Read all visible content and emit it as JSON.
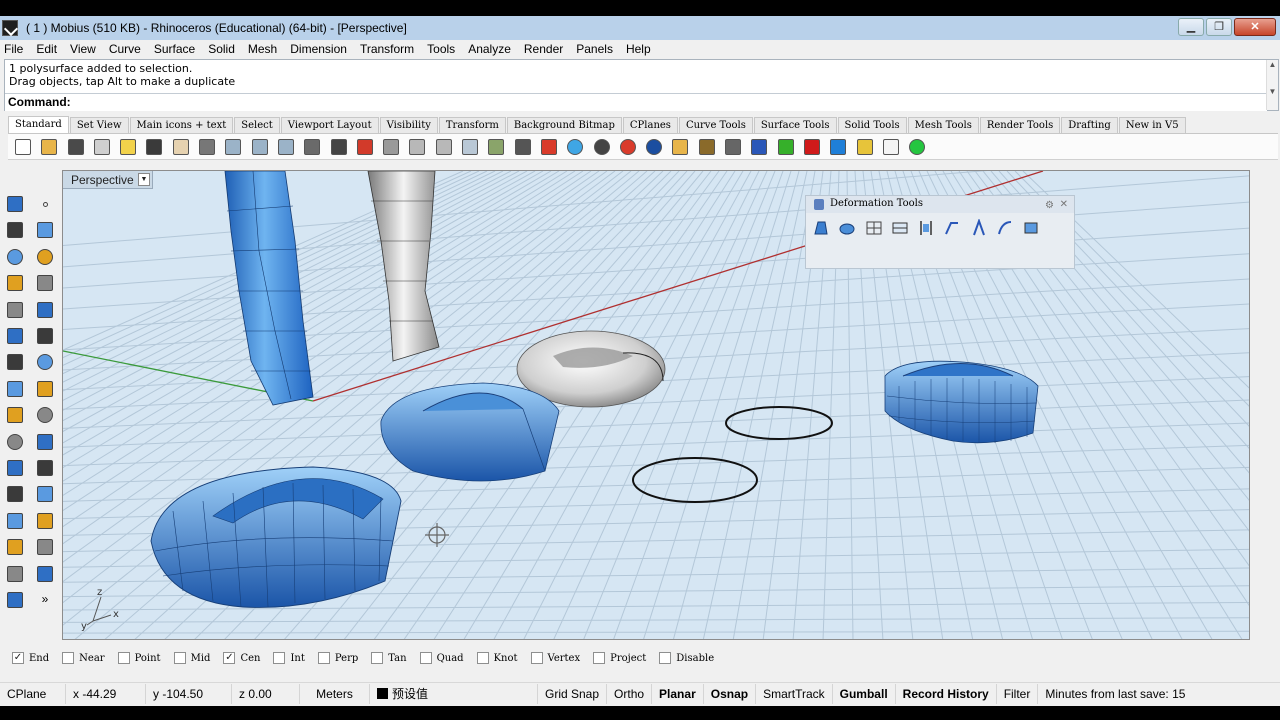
{
  "window": {
    "title": "( 1 ) Mobius (510 KB) - Rhinoceros (Educational) (64-bit) - [Perspective]",
    "buttons": [
      "▁",
      "❐",
      "✕"
    ]
  },
  "menu": [
    "File",
    "Edit",
    "View",
    "Curve",
    "Surface",
    "Solid",
    "Mesh",
    "Dimension",
    "Transform",
    "Tools",
    "Analyze",
    "Render",
    "Panels",
    "Help"
  ],
  "command": {
    "history": [
      "1 polysurface added to selection.",
      "Drag objects, tap Alt to make a duplicate"
    ],
    "prompt": "Command:"
  },
  "toolbar_tabs": [
    "Standard",
    "Set View",
    "Main icons + text",
    "Select",
    "Viewport Layout",
    "Visibility",
    "Transform",
    "Background Bitmap",
    "CPlanes",
    "Curve Tools",
    "Surface Tools",
    "Solid Tools",
    "Mesh Tools",
    "Render Tools",
    "Drafting",
    "New in V5"
  ],
  "toolbar_icons": [
    {
      "name": "new-icon",
      "color": "#ffffff"
    },
    {
      "name": "open-icon",
      "color": "#e8b54a"
    },
    {
      "name": "save-icon",
      "color": "#4a4a4a"
    },
    {
      "name": "print-icon",
      "color": "#cfcfcf"
    },
    {
      "name": "paste-icon",
      "color": "#f2d24b"
    },
    {
      "name": "undo-icon",
      "color": "#3a3a3a"
    },
    {
      "name": "pan-hand-icon",
      "color": "#e6d2b0"
    },
    {
      "name": "move-icon",
      "color": "#777777"
    },
    {
      "name": "zoom-icon",
      "color": "#9bb3c8"
    },
    {
      "name": "zoom-window-icon",
      "color": "#9bb3c8"
    },
    {
      "name": "zoom-extents-icon",
      "color": "#9bb3c8"
    },
    {
      "name": "rotate-view-icon",
      "color": "#6a6a6a"
    },
    {
      "name": "grid-icon",
      "color": "#444444"
    },
    {
      "name": "car-icon",
      "color": "#d23a2a"
    },
    {
      "name": "object-snap-icon",
      "color": "#9a9a9a"
    },
    {
      "name": "zoom-selected-icon",
      "color": "#b8b8b8"
    },
    {
      "name": "rotate-icon",
      "color": "#b8b8b8"
    },
    {
      "name": "light-bulb-icon",
      "color": "#b9c8d6"
    },
    {
      "name": "select-filter-icon",
      "color": "#8aa46a"
    },
    {
      "name": "lock-icon",
      "color": "#555555"
    },
    {
      "name": "layer-icon",
      "color": "#d93b2b"
    },
    {
      "name": "color-wheel-icon",
      "color": "#3fa6e5"
    },
    {
      "name": "render-sphere-icon",
      "color": "#444444"
    },
    {
      "name": "target-icon",
      "color": "#d93b2b"
    },
    {
      "name": "globe-icon",
      "color": "#1b4ea0"
    },
    {
      "name": "pencil-icon",
      "color": "#e8b54a"
    },
    {
      "name": "settings-icon",
      "color": "#8a6a2a"
    },
    {
      "name": "dimension-icon",
      "color": "#666666"
    },
    {
      "name": "help-icon",
      "color": "#2a57b8"
    },
    {
      "name": "green-tool-icon",
      "color": "#36b02a"
    },
    {
      "name": "red-tool-icon",
      "color": "#d01a1a"
    },
    {
      "name": "blue-tool-icon",
      "color": "#1f7fd8"
    },
    {
      "name": "yellow-tool-icon",
      "color": "#e7c43a"
    },
    {
      "name": "white-tool-icon",
      "color": "#f4f4f4"
    },
    {
      "name": "green-dot-icon",
      "color": "#25c640"
    }
  ],
  "left_tools": [
    [
      "select-arrow-icon",
      "point-icon"
    ],
    [
      "polyline-icon",
      "curve-icon"
    ],
    [
      "circle-icon",
      "ellipse-icon"
    ],
    [
      "arc-icon",
      "rectangle-icon"
    ],
    [
      "polygon-icon",
      "fillet-curve-icon"
    ],
    [
      "surface-from-points-icon",
      "extrude-surface-icon"
    ],
    [
      "solid-box-icon",
      "solid-sphere-icon"
    ],
    [
      "cylinder-icon",
      "solid-edit-icon"
    ],
    [
      "mesh-icon",
      "gumball-icon"
    ],
    [
      "boolean-icon",
      "dimension-tool-icon"
    ],
    [
      "trim-icon",
      "split-icon"
    ],
    [
      "text-icon",
      "point-edit-icon"
    ],
    [
      "block-icon",
      "array-icon"
    ],
    [
      "render-box-icon",
      "analyze-icon"
    ],
    [
      "grid-array-icon",
      "curvature-icon"
    ],
    [
      "drafting-icon",
      "more-tools-icon"
    ]
  ],
  "viewport": {
    "name": "Perspective"
  },
  "deformation_toolbar": {
    "title": "Deformation Tools"
  },
  "osnap": [
    {
      "label": "End",
      "checked": true
    },
    {
      "label": "Near",
      "checked": false
    },
    {
      "label": "Point",
      "checked": false
    },
    {
      "label": "Mid",
      "checked": false
    },
    {
      "label": "Cen",
      "checked": true
    },
    {
      "label": "Int",
      "checked": false
    },
    {
      "label": "Perp",
      "checked": false
    },
    {
      "label": "Tan",
      "checked": false
    },
    {
      "label": "Quad",
      "checked": false
    },
    {
      "label": "Knot",
      "checked": false
    },
    {
      "label": "Vertex",
      "checked": false
    },
    {
      "label": "Project",
      "checked": false
    },
    {
      "label": "Disable",
      "checked": false
    }
  ],
  "status": {
    "cplane": "CPlane",
    "x": "x -44.29",
    "y": "y -104.50",
    "z": "z 0.00",
    "units": "Meters",
    "layer": "预设值",
    "grid_snap": "Grid Snap",
    "ortho": "Ortho",
    "planar": "Planar",
    "osnap": "Osnap",
    "smarttrack": "SmartTrack",
    "gumball": "Gumball",
    "record_history": "Record History",
    "filter": "Filter",
    "last_save": "Minutes from last save: 15"
  },
  "axis_labels": {
    "x": "x",
    "y": "y",
    "z": "z"
  },
  "colors": {
    "titlebar": "#b9d1ea",
    "viewport_bg": "#d6e6f3",
    "surface_blue": "#3b8ee0"
  }
}
